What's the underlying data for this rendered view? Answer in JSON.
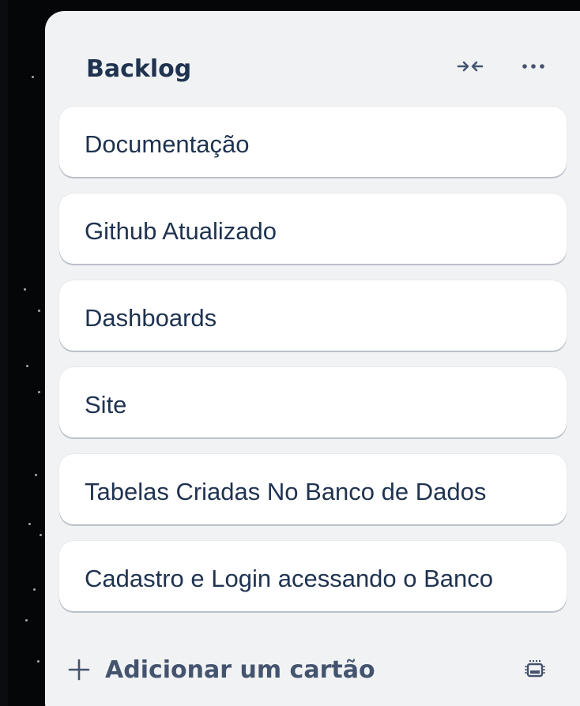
{
  "list": {
    "title": "Backlog",
    "header_icons": [
      "collapse-icon",
      "more-icon"
    ],
    "cards": [
      {
        "title": "Documentação"
      },
      {
        "title": "Github Atualizado"
      },
      {
        "title": "Dashboards"
      },
      {
        "title": "Site"
      },
      {
        "title": "Tabelas Criadas No Banco de Dados"
      },
      {
        "title": "Cadastro e Login acessando o Banco"
      }
    ],
    "footer": {
      "add_card_label": "Adicionar um cartão",
      "add_icon": "plus-icon",
      "template_icon": "card-template-icon"
    }
  },
  "colors": {
    "background": "#050608",
    "list_background": "#f1f2f4",
    "card_background": "#ffffff",
    "text": "#1f3350",
    "icon": "#44546f"
  }
}
